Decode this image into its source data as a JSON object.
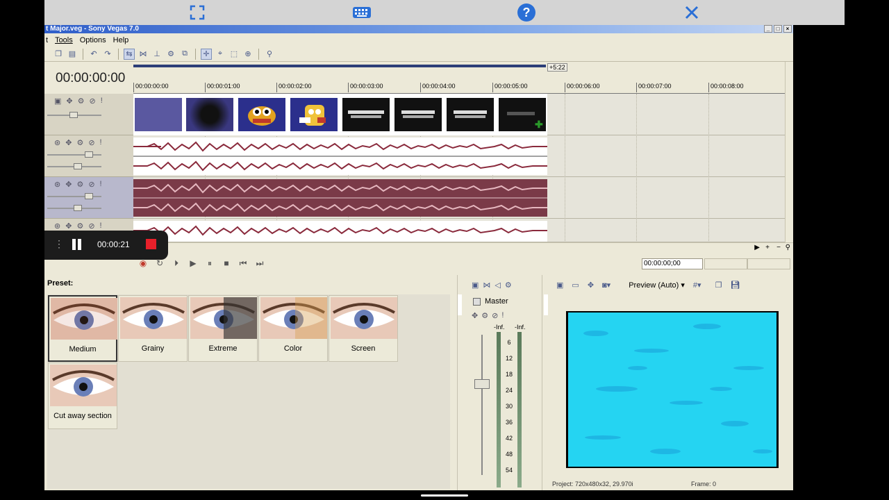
{
  "colors": {
    "accent": "#2f5ec9",
    "wave": "#8a2a3c",
    "preview": "#25d4f2",
    "record": "#e8202a"
  },
  "topbar": {
    "icons": [
      "fullscreen-icon",
      "keyboard-icon",
      "help-icon",
      "close-icon"
    ]
  },
  "window": {
    "title": "t Major.veg - Sony Vegas 7.0"
  },
  "menu": {
    "items": [
      "t",
      "Tools",
      "Options",
      "Help"
    ]
  },
  "timeline": {
    "cursor_time": "00:00:00:00",
    "loop_end": "+5:22",
    "ruler_ticks": [
      "00:00:00:00",
      "00:00:01:00",
      "00:00:02:00",
      "00:00:03:00",
      "00:00:04:00",
      "00:00:05:00",
      "00:00:06:00",
      "00:00:07:00",
      "00:00:08:00"
    ],
    "status_time": "00:00:00;00"
  },
  "recorder": {
    "elapsed": "00:00:21"
  },
  "fx": {
    "preset_title": "Preset:",
    "presets": [
      "Medium",
      "Grainy",
      "Extreme",
      "Color",
      "Screen",
      "Cut away section"
    ],
    "selected": "Medium"
  },
  "mixer": {
    "master_label": "Master",
    "peak_left": "-Inf.",
    "peak_right": "-Inf.",
    "scale": [
      "6",
      "12",
      "18",
      "24",
      "30",
      "36",
      "42",
      "48",
      "54"
    ]
  },
  "preview": {
    "mode": "Preview (Auto)",
    "project_info": "Project: 720x480x32, 29.970i",
    "frame_info": "Frame: 0"
  }
}
